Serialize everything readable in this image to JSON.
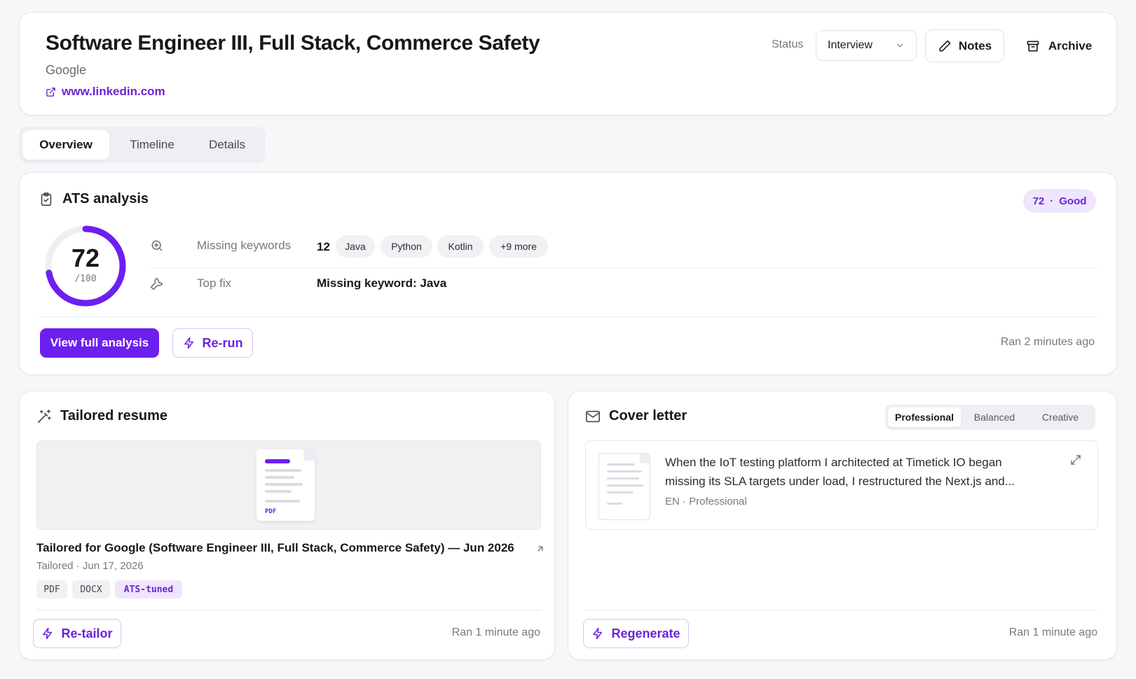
{
  "header": {
    "job_title": "Software Engineer III, Full Stack, Commerce Safety",
    "company": "Google",
    "link_text": "www.linkedin.com",
    "status_label": "Status",
    "status_value": "Interview",
    "notes_label": "Notes",
    "archive_label": "Archive"
  },
  "tabs": [
    "Overview",
    "Timeline",
    "Details"
  ],
  "ats": {
    "title": "ATS analysis",
    "badge_score": "72",
    "badge_sep": "·",
    "badge_rating": "Good",
    "score": "72",
    "score_denominator": "/100",
    "score_fraction": 0.72,
    "missing_keywords_label": "Missing keywords",
    "missing_keywords_count": "12",
    "keywords": [
      "Java",
      "Python",
      "Kotlin",
      "+9 more"
    ],
    "top_fix_label": "Top fix",
    "top_fix_value": "Missing keyword: Java",
    "view_button": "View full analysis",
    "rerun_button": "Re-run",
    "ran": "Ran 2 minutes ago"
  },
  "resume": {
    "title": "Tailored resume",
    "preview_type": "PDF",
    "doc_title": "Tailored for Google (Software Engineer III, Full Stack, Commerce Safety) — Jun 2026",
    "meta": "Tailored · Jun 17, 2026",
    "tags": [
      "PDF",
      "DOCX",
      "ATS-tuned"
    ],
    "retailor_button": "Re-tailor",
    "ran": "Ran 1 minute ago"
  },
  "cover": {
    "title": "Cover letter",
    "tones": [
      "Professional",
      "Balanced",
      "Creative"
    ],
    "excerpt": "When the IoT testing platform I architected at Timetick IO began missing its SLA targets under load, I restructured the Next.js and...",
    "meta": "EN · Professional",
    "regenerate_button": "Regenerate",
    "ran": "Ran 1 minute ago"
  },
  "colors": {
    "accent": "#6d1ff0",
    "accent_text": "#6a24d8",
    "badge_bg": "#efe6fd"
  }
}
